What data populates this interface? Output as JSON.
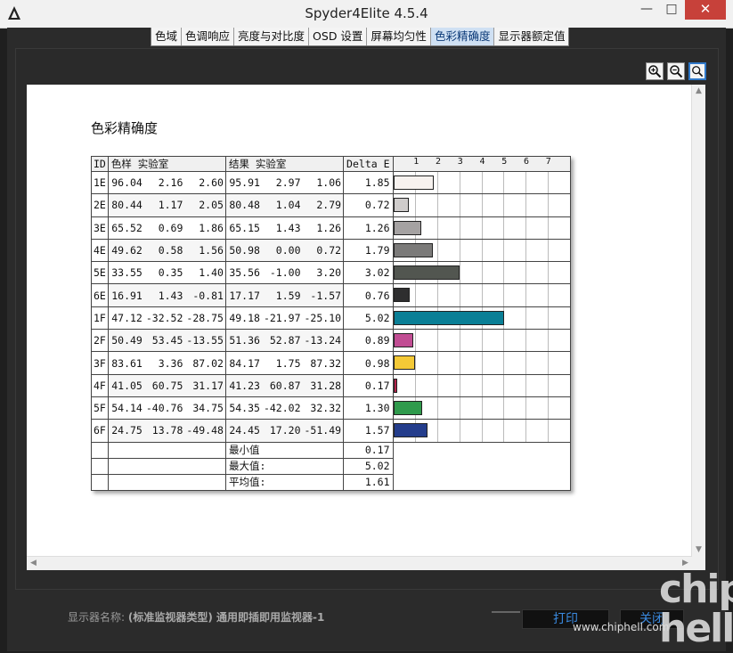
{
  "window": {
    "title": "Spyder4Elite 4.5.4",
    "min": "—",
    "max": "□",
    "close": "✕"
  },
  "tabs": [
    "色域",
    "色调响应",
    "亮度与对比度",
    "OSD 设置",
    "屏幕均匀性",
    "色彩精确度",
    "显示器额定值"
  ],
  "active_tab": 5,
  "report": {
    "title": "色彩精确度",
    "headers": {
      "id": "ID",
      "sample": "色样 实验室",
      "result": "结果 实验室",
      "delta": "Delta E"
    },
    "axis_ticks": [
      "1",
      "2",
      "3",
      "4",
      "5",
      "6",
      "7"
    ],
    "summary": [
      {
        "label": "最小值",
        "value": "0.17"
      },
      {
        "label": "最大值:",
        "value": "5.02"
      },
      {
        "label": "平均值:",
        "value": "1.61"
      }
    ]
  },
  "chart_data": {
    "type": "table",
    "rows": [
      {
        "id": "1E",
        "sample": [
          "96.04",
          "2.16",
          "2.60"
        ],
        "result": [
          "95.91",
          "2.97",
          "1.06"
        ],
        "delta": "1.85",
        "color": "#f7f2ef"
      },
      {
        "id": "2E",
        "sample": [
          "80.44",
          "1.17",
          "2.05"
        ],
        "result": [
          "80.48",
          "1.04",
          "2.79"
        ],
        "delta": "0.72",
        "color": "#cfcccb"
      },
      {
        "id": "3E",
        "sample": [
          "65.52",
          "0.69",
          "1.86"
        ],
        "result": [
          "65.15",
          "1.43",
          "1.26"
        ],
        "delta": "1.26",
        "color": "#a5a2a2"
      },
      {
        "id": "4E",
        "sample": [
          "49.62",
          "0.58",
          "1.56"
        ],
        "result": [
          "50.98",
          "0.00",
          "0.72"
        ],
        "delta": "1.79",
        "color": "#7b7a79"
      },
      {
        "id": "5E",
        "sample": [
          "33.55",
          "0.35",
          "1.40"
        ],
        "result": [
          "35.56",
          "-1.00",
          "3.20"
        ],
        "delta": "3.02",
        "color": "#525650"
      },
      {
        "id": "6E",
        "sample": [
          "16.91",
          "1.43",
          "-0.81"
        ],
        "result": [
          "17.17",
          "1.59",
          "-1.57"
        ],
        "delta": "0.76",
        "color": "#2e2e2f"
      },
      {
        "id": "1F",
        "sample": [
          "47.12",
          "-32.52",
          "-28.75"
        ],
        "result": [
          "49.18",
          "-21.97",
          "-25.10"
        ],
        "delta": "5.02",
        "color": "#0a7f96"
      },
      {
        "id": "2F",
        "sample": [
          "50.49",
          "53.45",
          "-13.55"
        ],
        "result": [
          "51.36",
          "52.87",
          "-13.24"
        ],
        "delta": "0.89",
        "color": "#c14d93"
      },
      {
        "id": "3F",
        "sample": [
          "83.61",
          "3.36",
          "87.02"
        ],
        "result": [
          "84.17",
          "1.75",
          "87.32"
        ],
        "delta": "0.98",
        "color": "#f4c936"
      },
      {
        "id": "4F",
        "sample": [
          "41.05",
          "60.75",
          "31.17"
        ],
        "result": [
          "41.23",
          "60.87",
          "31.28"
        ],
        "delta": "0.17",
        "color": "#b3234b"
      },
      {
        "id": "5F",
        "sample": [
          "54.14",
          "-40.76",
          "34.75"
        ],
        "result": [
          "54.35",
          "-42.02",
          "32.32"
        ],
        "delta": "1.30",
        "color": "#2f9a4c"
      },
      {
        "id": "6F",
        "sample": [
          "24.75",
          "13.78",
          "-49.48"
        ],
        "result": [
          "24.45",
          "17.20",
          "-51.49"
        ],
        "delta": "1.57",
        "color": "#243d8c"
      }
    ],
    "bar_axis_max": 8
  },
  "footer": {
    "monitor_label": "显示器名称:",
    "monitor_name": "(标准监视器类型) 通用即插即用监视器-1",
    "print": "打印",
    "close": "关闭"
  },
  "watermark": {
    "logo": "chip hell",
    "url": "www.chiphell.com"
  }
}
